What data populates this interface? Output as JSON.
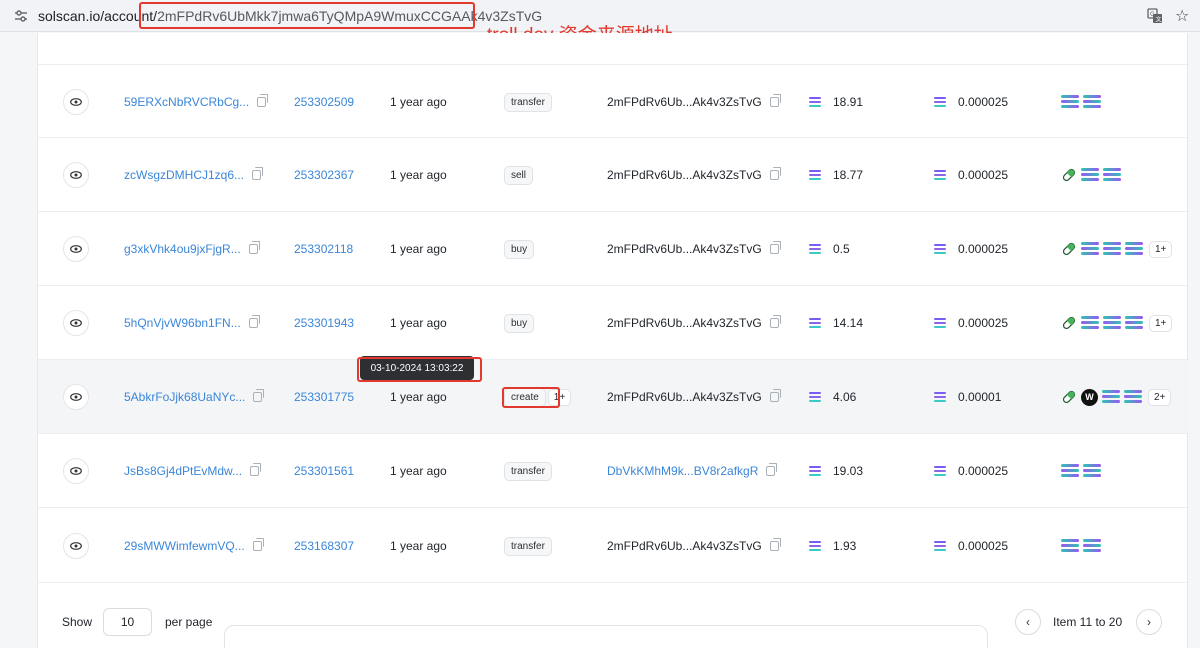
{
  "browser": {
    "url_host": "solscan.io/account/",
    "url_path": "2mFPdRv6UbMkk7jmwa6TyQMpA9WmuxCCGAAk4v3ZsTvG",
    "annotation": "troll dev 资金来源地址"
  },
  "rows": [
    {
      "sig": "59ERXcNbRVCRbCg...",
      "block": "253302509",
      "age": "1 year ago",
      "type": "transfer",
      "by": "2mFPdRv6Ub...Ak4v3ZsTvG",
      "by_link": false,
      "value": "18.91",
      "fee": "0.000025",
      "tokens": [
        "sol",
        "sol"
      ],
      "more": ""
    },
    {
      "sig": "zcWsgzDMHCJ1zq6...",
      "block": "253302367",
      "age": "1 year ago",
      "type": "sell",
      "by": "2mFPdRv6Ub...Ak4v3ZsTvG",
      "by_link": false,
      "value": "18.77",
      "fee": "0.000025",
      "tokens": [
        "pill",
        "sol",
        "sol"
      ],
      "more": ""
    },
    {
      "sig": "g3xkVhk4ou9jxFjgR...",
      "block": "253302118",
      "age": "1 year ago",
      "type": "buy",
      "by": "2mFPdRv6Ub...Ak4v3ZsTvG",
      "by_link": false,
      "value": "0.5",
      "fee": "0.000025",
      "tokens": [
        "pill",
        "sol",
        "sol",
        "sol"
      ],
      "more": "1+"
    },
    {
      "sig": "5hQnVjvW96bn1FN...",
      "block": "253301943",
      "age": "1 year ago",
      "type": "buy",
      "by": "2mFPdRv6Ub...Ak4v3ZsTvG",
      "by_link": false,
      "value": "14.14",
      "fee": "0.000025",
      "tokens": [
        "pill",
        "sol",
        "sol",
        "sol"
      ],
      "more": "1+"
    },
    {
      "sig": "5AbkrFoJjk68UaNYc...",
      "block": "253301775",
      "age": "1 year ago",
      "type": "create",
      "type_more": "1+",
      "by": "2mFPdRv6Ub...Ak4v3ZsTvG",
      "by_link": false,
      "value": "4.06",
      "fee": "0.00001",
      "tokens": [
        "pill",
        "w",
        "sol",
        "sol"
      ],
      "more": "2+"
    },
    {
      "sig": "JsBs8Gj4dPtEvMdw...",
      "block": "253301561",
      "age": "1 year ago",
      "type": "transfer",
      "by": "DbVkKMhM9k...BV8r2afkgR",
      "by_link": true,
      "value": "19.03",
      "fee": "0.000025",
      "tokens": [
        "sol",
        "sol"
      ],
      "more": ""
    },
    {
      "sig": "29sMWWimfewmVQ...",
      "block": "253168307",
      "age": "1 year ago",
      "type": "transfer",
      "by": "2mFPdRv6Ub...Ak4v3ZsTvG",
      "by_link": false,
      "value": "1.93",
      "fee": "0.000025",
      "tokens": [
        "sol",
        "sol"
      ],
      "more": ""
    }
  ],
  "tooltip": "03-10-2024 13:03:22",
  "footer": {
    "show_label": "Show",
    "per_page_value": "10",
    "per_page_label": "per page",
    "page_label": "Item 11 to 20"
  },
  "colors": {
    "accent": "#3a86d8",
    "annotation_red": "#e2382d"
  }
}
